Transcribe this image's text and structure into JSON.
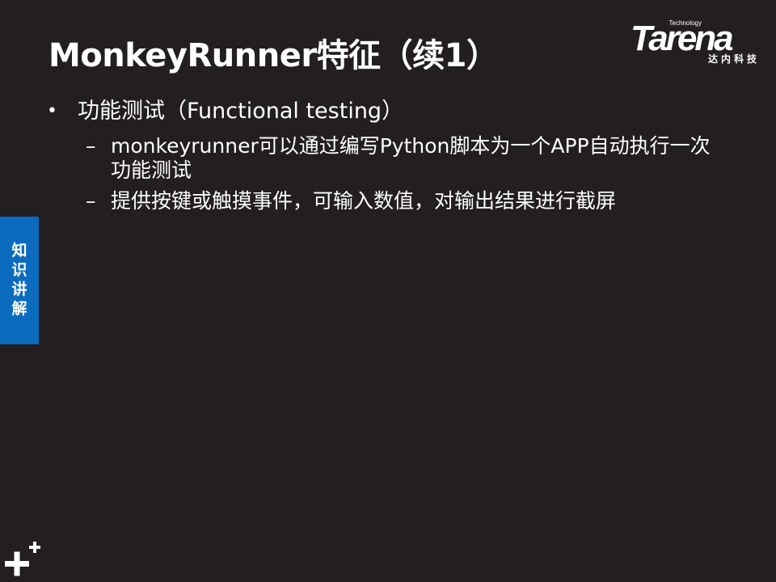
{
  "title": "MonkeyRunner特征（续1）",
  "logo": {
    "wordmark": "Tarena",
    "tagline": "Technology",
    "cn": "达内科技"
  },
  "side_tab": {
    "label": "知识讲解"
  },
  "content": {
    "bullet": {
      "marker": "•",
      "text": "功能测试（Functional testing）"
    },
    "sub_items": [
      {
        "marker": "–",
        "text": "monkeyrunner可以通过编写Python脚本为一个APP自动执行一次功能测试"
      },
      {
        "marker": "–",
        "text": "提供按键或触摸事件，可输入数值，对输出结果进行截屏"
      }
    ]
  },
  "icons": {
    "corner": "plus-plus-icon"
  },
  "colors": {
    "background": "#231f20",
    "text": "#ffffff",
    "side_tab": "#0a6bbf"
  }
}
